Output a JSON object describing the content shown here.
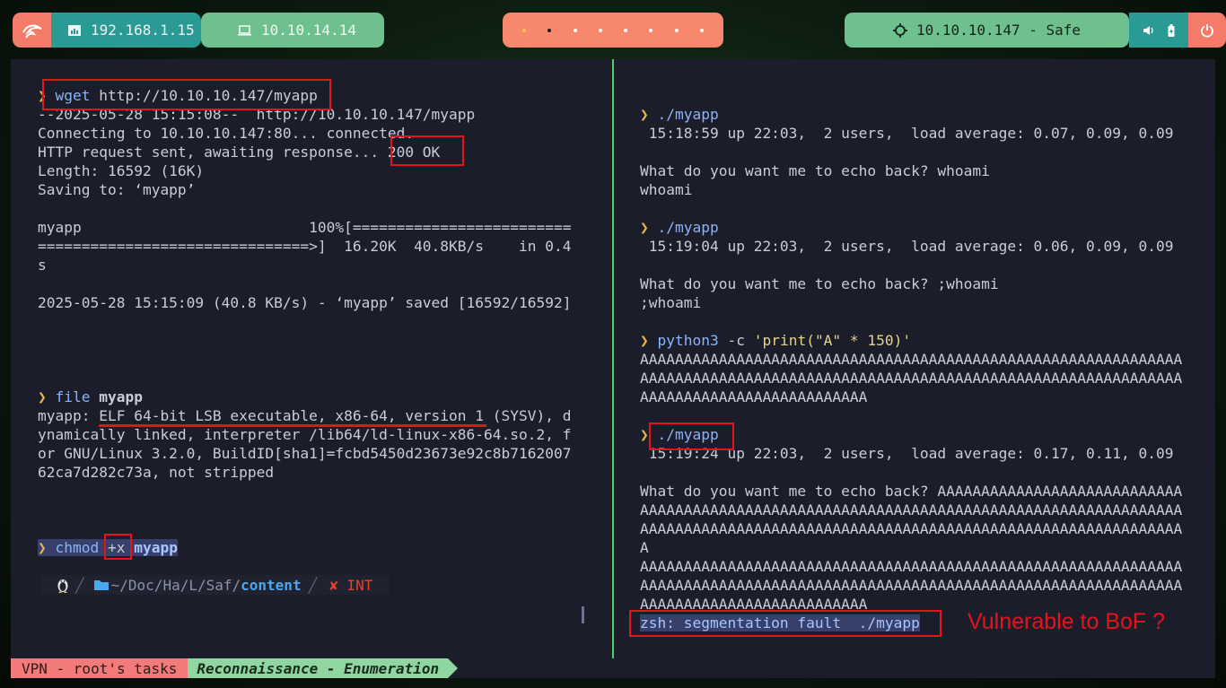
{
  "topbar": {
    "local_ip": "192.168.1.15",
    "vpn_ip": "10.10.14.14",
    "target": "10.10.10.147 - Safe",
    "workspaces": 8,
    "active_workspace": 2,
    "icons": {
      "logo": "kali-dragon-icon",
      "local": "network-icon",
      "vpn": "laptop-icon",
      "target": "crosshair-icon",
      "volume": "volume-icon",
      "battery": "battery-icon",
      "power": "power-icon"
    }
  },
  "left_pane": {
    "lines": [
      {
        "prompt": "❯",
        "cmd": "wget",
        "rest": " http://10.10.10.147/myapp"
      },
      {
        "text": "--2025-05-28 15:15:08--  http://10.10.10.147/myapp"
      },
      {
        "text": "Connecting to 10.10.10.147:80... connected."
      },
      {
        "text": "HTTP request sent, awaiting response... 200 OK"
      },
      {
        "text": "Length: 16592 (16K)"
      },
      {
        "text": "Saving to: ‘myapp’"
      },
      {
        "text": ""
      },
      {
        "text": "myapp                          100%[========================="
      },
      {
        "text": "===============================>]  16.20K  40.8KB/s    in 0.4"
      },
      {
        "text": "s"
      },
      {
        "text": ""
      },
      {
        "text": "2025-05-28 15:15:09 (40.8 KB/s) - ‘myapp’ saved [16592/16592]"
      },
      {
        "text": ""
      },
      {
        "text": ""
      },
      {
        "text": ""
      },
      {
        "text": ""
      },
      {
        "prompt": "❯",
        "cmd": "file",
        "bold": " myapp"
      },
      {
        "text": "myapp: ELF 64-bit LSB executable, x86-64, version 1 (SYSV), d"
      },
      {
        "text": "ynamically linked, interpreter /lib64/ld-linux-x86-64.so.2, f"
      },
      {
        "text": "or GNU/Linux 3.2.0, BuildID[sha1]=fcbd5450d23673e92c8b7162007"
      },
      {
        "text": "62ca7d282c73a, not stripped"
      },
      {
        "text": ""
      },
      {
        "text": ""
      },
      {
        "text": ""
      },
      {
        "prompt": "❯",
        "cmd": "chmod",
        "rest": " +x",
        "bold": " myapp",
        "selected": true
      }
    ]
  },
  "prompt": {
    "os_icon": "linux-penguin-icon",
    "folder_icon": "folder-icon",
    "path": "~/Doc/Ha/L/Saf/",
    "cwd": "content",
    "status": "✘ INT"
  },
  "right_pane": {
    "lines": [
      {
        "prompt": "❯",
        "cmd": "./myapp"
      },
      {
        "text": " 15:18:59 up 22:03,  2 users,  load average: 0.07, 0.09, 0.09"
      },
      {
        "text": ""
      },
      {
        "text": "What do you want me to echo back? whoami"
      },
      {
        "text": "whoami"
      },
      {
        "text": ""
      },
      {
        "prompt": "❯",
        "cmd": "./myapp"
      },
      {
        "text": " 15:19:04 up 22:03,  2 users,  load average: 0.06, 0.09, 0.09"
      },
      {
        "text": ""
      },
      {
        "text": "What do you want me to echo back? ;whoami"
      },
      {
        "text": ";whoami"
      },
      {
        "text": ""
      },
      {
        "prompt": "❯",
        "cmd": "python3",
        "rest": " -c ",
        "str": "'print(\"A\" * 150)'"
      },
      {
        "text": "AAAAAAAAAAAAAAAAAAAAAAAAAAAAAAAAAAAAAAAAAAAAAAAAAAAAAAAAAAAAAA"
      },
      {
        "text": "AAAAAAAAAAAAAAAAAAAAAAAAAAAAAAAAAAAAAAAAAAAAAAAAAAAAAAAAAAAAAA"
      },
      {
        "text": "AAAAAAAAAAAAAAAAAAAAAAAAAA"
      },
      {
        "text": ""
      },
      {
        "prompt": "❯",
        "cmd": "./myapp"
      },
      {
        "text": " 15:19:24 up 22:03,  2 users,  load average: 0.17, 0.11, 0.09"
      },
      {
        "text": ""
      },
      {
        "text": "What do you want me to echo back? AAAAAAAAAAAAAAAAAAAAAAAAAAAA"
      },
      {
        "text": "AAAAAAAAAAAAAAAAAAAAAAAAAAAAAAAAAAAAAAAAAAAAAAAAAAAAAAAAAAAAAA"
      },
      {
        "text": "AAAAAAAAAAAAAAAAAAAAAAAAAAAAAAAAAAAAAAAAAAAAAAAAAAAAAAAAAAAAAA"
      },
      {
        "text": "A"
      },
      {
        "text": "AAAAAAAAAAAAAAAAAAAAAAAAAAAAAAAAAAAAAAAAAAAAAAAAAAAAAAAAAAAAAA"
      },
      {
        "text": "AAAAAAAAAAAAAAAAAAAAAAAAAAAAAAAAAAAAAAAAAAAAAAAAAAAAAAAAAAAAAA"
      },
      {
        "text": "AAAAAAAAAAAAAAAAAAAAAAAAAA"
      },
      {
        "text": "zsh: segmentation fault  ./myapp",
        "selected": true
      }
    ]
  },
  "annotation": "Vulnerable to BoF ?",
  "tmux": {
    "session": "VPN - root's tasks",
    "window": "Reconnaissance - Enumeration"
  },
  "colors": {
    "accent_red": "#e8131a",
    "green": "#4fd06a",
    "terminal_bg": "#1b1d2a"
  }
}
